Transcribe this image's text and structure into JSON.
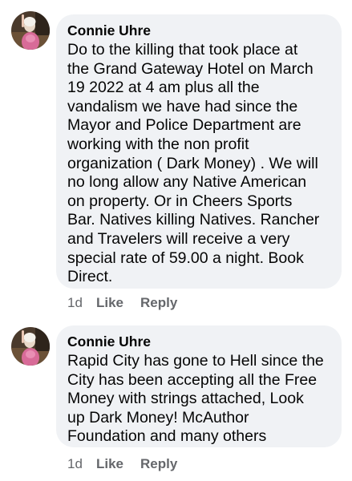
{
  "comments": [
    {
      "author": "Connie Uhre",
      "text": "Do to the killing that took place at\nthe Grand Gateway Hotel on March\n19 2022 at 4 am plus all the\nvandalism we have had since the\nMayor and Police Department are\nworking with the non profit\norganization ( Dark Money)  . We will\nno long allow any Native American\non  property. Or in Cheers Sports\nBar. Natives killing Natives. Rancher\nand Travelers will receive a very\nspecial rate of 59.00 a night. Book\nDirect.",
      "time": "1d",
      "like_label": "Like",
      "reply_label": "Reply"
    },
    {
      "author": "Connie Uhre",
      "text": "Rapid City has gone to Hell since the\nCity has been accepting all the Free\nMoney with strings attached, Look\nup Dark Money! McAuthor\nFoundation and many others",
      "time": "1d",
      "like_label": "Like",
      "reply_label": "Reply"
    }
  ],
  "colors": {
    "bubble": "#f0f2f5",
    "action_text": "#65676b",
    "body_text": "#050505"
  },
  "icons": {
    "avatar": "profile-photo-avatar"
  }
}
